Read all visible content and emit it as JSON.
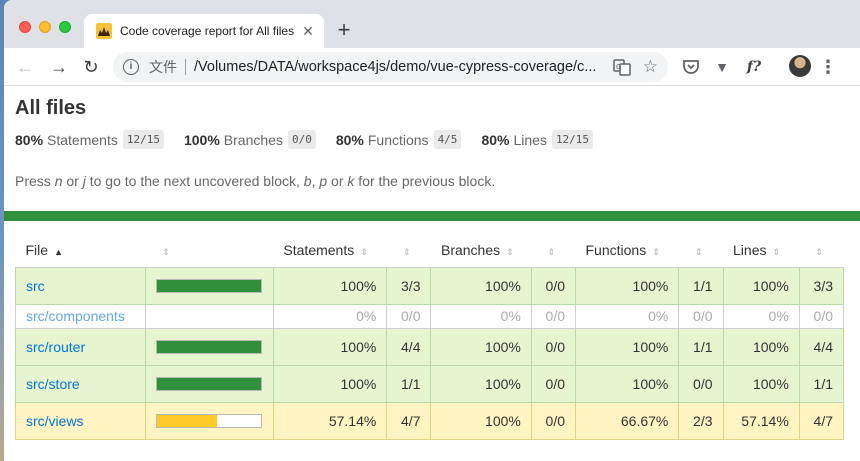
{
  "browser": {
    "tab_title": "Code coverage report for All files",
    "address": {
      "secure_label": "文件",
      "url": "/Volumes/DATA/workspace4js/demo/vue-cypress-coverage/c..."
    },
    "icons": {
      "tab_close": "close-icon",
      "new_tab": "plus-icon",
      "back": "arrow-left-icon",
      "forward": "arrow-right-icon",
      "reload": "reload-icon",
      "site_info": "info-icon",
      "translate": "translate-icon",
      "bookmark": "star-icon",
      "pocket": "pocket-icon",
      "extension_v": "vuejs-devtools-icon",
      "extension_f": "f-question-icon",
      "profile": "avatar",
      "menu": "kebab-menu-icon"
    }
  },
  "report": {
    "title": "All files",
    "summary": [
      {
        "pct": "80%",
        "label": "Statements",
        "fraction": "12/15"
      },
      {
        "pct": "100%",
        "label": "Branches",
        "fraction": "0/0"
      },
      {
        "pct": "80%",
        "label": "Functions",
        "fraction": "4/5"
      },
      {
        "pct": "80%",
        "label": "Lines",
        "fraction": "12/15"
      }
    ],
    "help": {
      "pre": "Press ",
      "n": "n",
      "or1": " or ",
      "j": "j",
      "mid": " to go to the next uncovered block, ",
      "b": "b",
      "comma": ", ",
      "p": "p",
      "or2": " or ",
      "k": "k",
      "post": " for the previous block."
    },
    "colors": {
      "high": "#2f8f3b",
      "medium": "#ffc928",
      "high_row": "#e6f5d0",
      "medium_row": "#fff4c2",
      "link": "#0074d9"
    },
    "columns": {
      "file": "File",
      "statements": "Statements",
      "branches": "Branches",
      "functions": "Functions",
      "lines": "Lines",
      "sort_asc": "▲",
      "sortable": "⇕"
    },
    "rows": [
      {
        "file": "src",
        "coverage": 1.0,
        "level": "high",
        "stmt_pct": "100%",
        "stmt_frac": "3/3",
        "br_pct": "100%",
        "br_frac": "0/0",
        "fn_pct": "100%",
        "fn_frac": "1/1",
        "ln_pct": "100%",
        "ln_frac": "3/3"
      },
      {
        "file": "src/components",
        "coverage": 0.0,
        "level": "empty",
        "stmt_pct": "0%",
        "stmt_frac": "0/0",
        "br_pct": "0%",
        "br_frac": "0/0",
        "fn_pct": "0%",
        "fn_frac": "0/0",
        "ln_pct": "0%",
        "ln_frac": "0/0"
      },
      {
        "file": "src/router",
        "coverage": 1.0,
        "level": "high",
        "stmt_pct": "100%",
        "stmt_frac": "4/4",
        "br_pct": "100%",
        "br_frac": "0/0",
        "fn_pct": "100%",
        "fn_frac": "1/1",
        "ln_pct": "100%",
        "ln_frac": "4/4"
      },
      {
        "file": "src/store",
        "coverage": 1.0,
        "level": "high",
        "stmt_pct": "100%",
        "stmt_frac": "1/1",
        "br_pct": "100%",
        "br_frac": "0/0",
        "fn_pct": "100%",
        "fn_frac": "0/0",
        "ln_pct": "100%",
        "ln_frac": "1/1"
      },
      {
        "file": "src/views",
        "coverage": 0.5714,
        "level": "medium",
        "stmt_pct": "57.14%",
        "stmt_frac": "4/7",
        "br_pct": "100%",
        "br_frac": "0/0",
        "fn_pct": "66.67%",
        "fn_frac": "2/3",
        "ln_pct": "57.14%",
        "ln_frac": "4/7"
      }
    ]
  }
}
